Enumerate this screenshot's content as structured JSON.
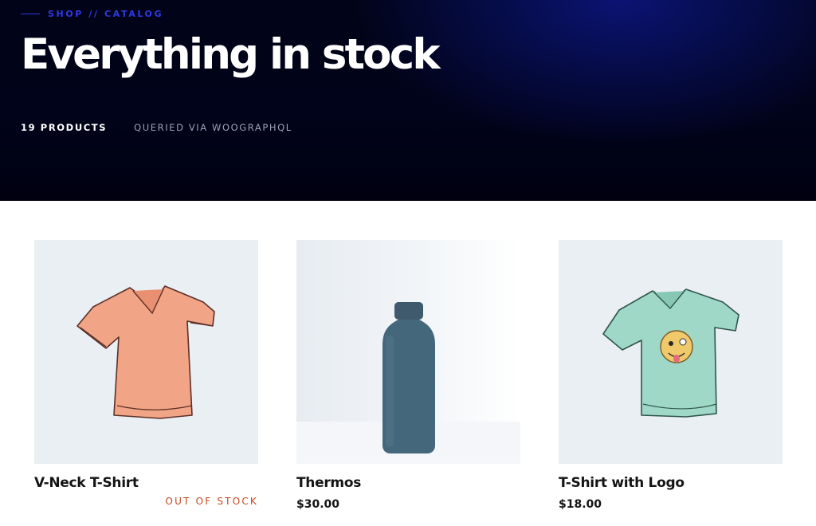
{
  "hero": {
    "eyebrow": "SHOP // CATALOG",
    "title": "Everything in stock",
    "product_count": "19 PRODUCTS",
    "source": "QUERIED VIA WOOGRAPHQL"
  },
  "products": [
    {
      "name": "V-Neck T-Shirt",
      "price": "",
      "stock": "OUT OF STOCK",
      "image": "orange-vneck-tshirt-icon"
    },
    {
      "name": "Thermos",
      "price": "$30.00",
      "stock": "",
      "image": "blue-thermos-bottle-icon"
    },
    {
      "name": "T-Shirt with Logo",
      "price": "$18.00",
      "stock": "",
      "image": "green-logo-tshirt-icon"
    }
  ],
  "colors": {
    "hero_bg": "#01031a",
    "accent": "#2f39e6",
    "out_of_stock": "#c8471f",
    "thumb_bg": "#eaeff4"
  }
}
